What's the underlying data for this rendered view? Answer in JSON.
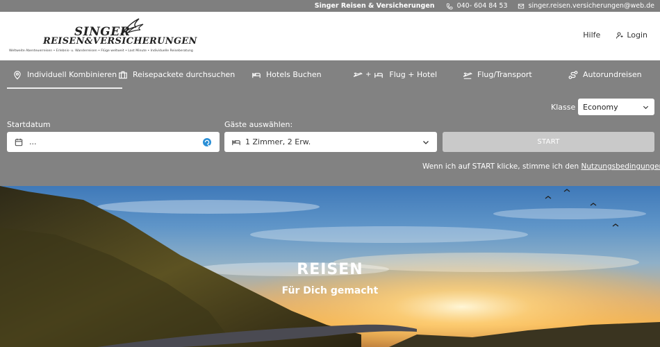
{
  "topbar": {
    "company": "Singer Reisen & Versicherungen",
    "phone": "040- 604 84 53",
    "email": "singer.reisen.versicherungen@web.de"
  },
  "logo": {
    "line1": "SINGER",
    "line2": "REISEN&VERSICHERUNGEN",
    "tagline": "Weltweite Abenteuerreisen • Erlebnis- u. Wanderreisen • Flüge weltweit • Last Minute • Individuelle Reiseberatung"
  },
  "header": {
    "help": "Hilfe",
    "login": "Login"
  },
  "nav": {
    "tabs": [
      {
        "label": "Individuell Kombinieren",
        "icon": "map-pin-icon",
        "active": true
      },
      {
        "label": "Reisepackete durchsuchen",
        "icon": "suitcase-icon",
        "active": false
      },
      {
        "label": "Hotels Buchen",
        "icon": "bed-icon",
        "active": false
      },
      {
        "label": "Flug + Hotel",
        "icon": "plane-bed-icon",
        "plus": "+",
        "active": false
      },
      {
        "label": "Flug/Transport",
        "icon": "plane-icon",
        "active": false
      },
      {
        "label": "Autorundreisen",
        "icon": "route-icon",
        "active": false
      }
    ]
  },
  "search": {
    "klasse_label": "Klasse",
    "klasse_value": "Economy",
    "startdatum_label": "Startdatum",
    "startdatum_value": "...",
    "gaeste_label": "Gäste auswählen:",
    "gaeste_value": "1 Zimmer, 2 Erw.",
    "start_button": "START",
    "terms_text": "Wenn ich auf START klicke, stimme ich den ",
    "terms_link": "Nutzungsbedingungen zu"
  },
  "hero": {
    "title": "REISEN",
    "subtitle": "Für Dich gemacht"
  },
  "colors": {
    "panel_bg": "#828282",
    "header_bg": "#ffffff",
    "start_button_bg": "#c9c9c9"
  }
}
